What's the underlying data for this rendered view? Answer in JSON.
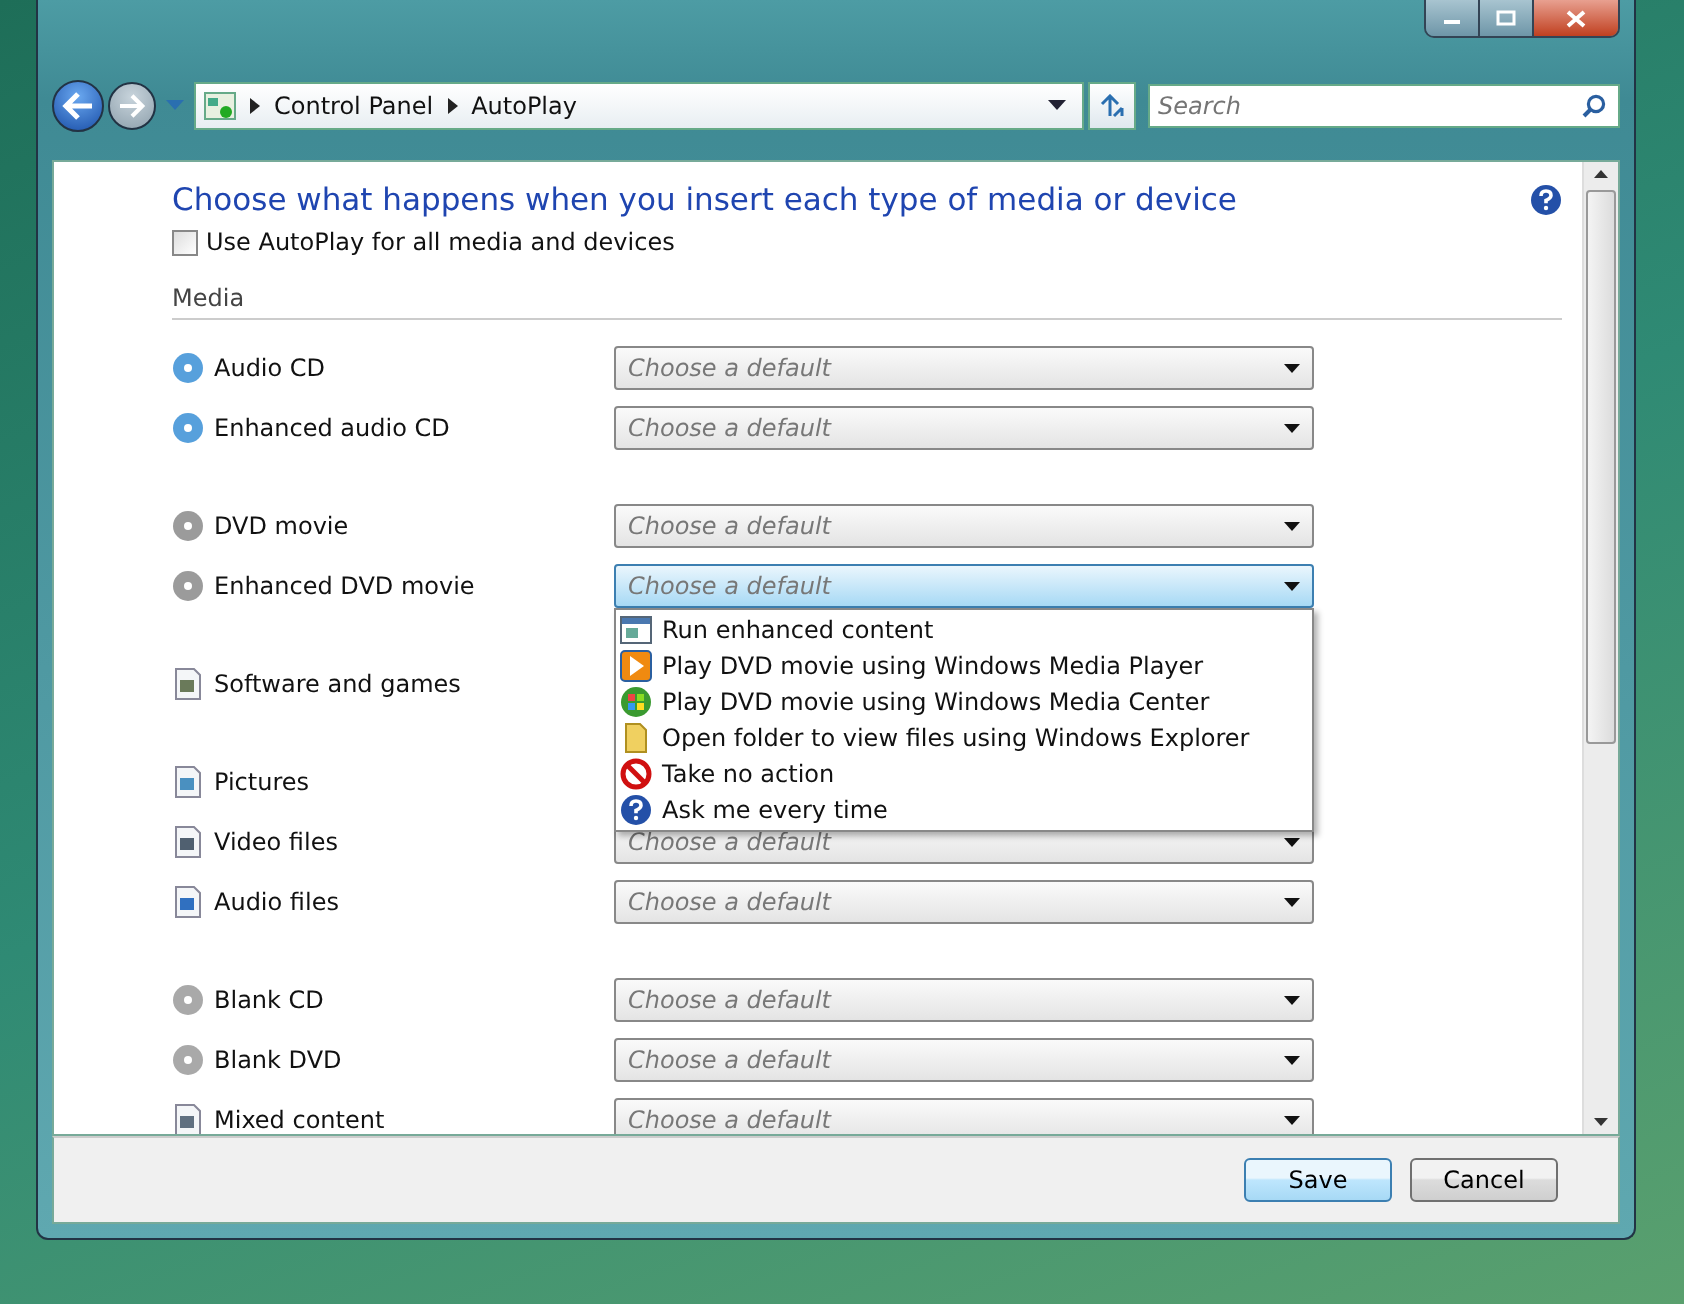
{
  "address_bar": {
    "path": [
      "Control Panel",
      "AutoPlay"
    ]
  },
  "search": {
    "placeholder": "Search"
  },
  "heading": "Choose what happens when you insert each type of media or device",
  "autoplay_all": {
    "label": "Use AutoPlay for all media and devices",
    "checked": false
  },
  "section": "Media",
  "groups": [
    {
      "rows": [
        {
          "kind": "cd",
          "label": "Audio CD",
          "placeholder": "Choose a default",
          "open": false
        },
        {
          "kind": "cd",
          "label": "Enhanced audio CD",
          "placeholder": "Choose a default",
          "open": false
        }
      ]
    },
    {
      "rows": [
        {
          "kind": "dvd",
          "label": "DVD movie",
          "placeholder": "Choose a default",
          "open": false
        },
        {
          "kind": "dvd",
          "label": "Enhanced DVD movie",
          "placeholder": "Choose a default",
          "open": true,
          "options": [
            {
              "kind": "window",
              "label": "Run enhanced content"
            },
            {
              "kind": "player",
              "label": "Play DVD movie using Windows Media Player"
            },
            {
              "kind": "center",
              "label": "Play DVD movie using Windows Media Center"
            },
            {
              "kind": "folder",
              "label": "Open folder to view files using Windows Explorer"
            },
            {
              "kind": "stop",
              "label": "Take no action"
            },
            {
              "kind": "help",
              "label": "Ask me every time"
            }
          ]
        }
      ]
    },
    {
      "rows": [
        {
          "kind": "software",
          "label": "Software and games"
        }
      ]
    },
    {
      "rows": [
        {
          "kind": "picture",
          "label": "Pictures"
        },
        {
          "kind": "video",
          "label": "Video files",
          "placeholder": "Choose a default",
          "open": false
        },
        {
          "kind": "audio",
          "label": "Audio files",
          "placeholder": "Choose a default",
          "open": false
        }
      ]
    },
    {
      "rows": [
        {
          "kind": "blank",
          "label": "Blank CD",
          "placeholder": "Choose a default",
          "open": false
        },
        {
          "kind": "blank",
          "label": "Blank DVD",
          "placeholder": "Choose a default",
          "open": false
        },
        {
          "kind": "mixed",
          "label": "Mixed content",
          "placeholder": "Choose a default",
          "open": false
        }
      ]
    }
  ],
  "buttons": [
    {
      "label": "Save",
      "kind": "default"
    },
    {
      "label": "Cancel",
      "kind": "normal"
    }
  ]
}
